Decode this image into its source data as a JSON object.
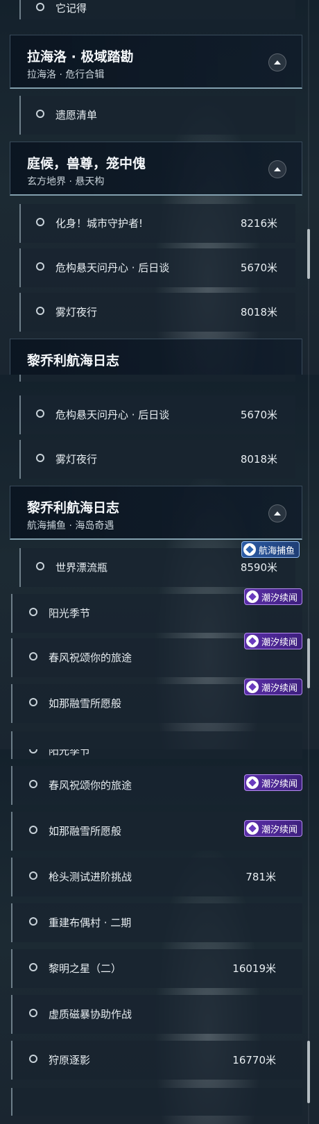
{
  "colors": {
    "tag_purple": "#5a2ea8",
    "tag_blue": "#2b5aa3",
    "panel": "#0b1620"
  },
  "section1": {
    "top_item": "它记得",
    "group_a": {
      "title": "拉海洛 · 极域踏勘",
      "subtitle": "拉海洛 · 危行合辑"
    },
    "group_a_items": [
      {
        "label": "遗愿清单"
      }
    ],
    "group_b": {
      "title": "庭候，兽尊，笼中傀",
      "subtitle": "玄方地界 · 悬天构"
    },
    "group_b_items": [
      {
        "label": "化身！城市守护者!",
        "dist": "8216米"
      },
      {
        "label": "危构悬天问丹心 · 后日谈",
        "dist": "5670米"
      },
      {
        "label": "雾灯夜行",
        "dist": "8018米"
      }
    ],
    "group_c_title": "黎乔利航海日志"
  },
  "section2": {
    "items": [
      {
        "label": "危构悬天问丹心 · 后日谈",
        "dist": "5670米"
      },
      {
        "label": "雾灯夜行",
        "dist": "8018米"
      }
    ],
    "group": {
      "title": "黎乔利航海日志",
      "subtitle": "航海捕鱼 · 海岛奇遇"
    },
    "group_items": [
      {
        "label": "世界漂流瓶",
        "dist": "8590米",
        "tag": "航海捕鱼"
      },
      {
        "label": "阳光季节",
        "tag": "潮汐续闻"
      },
      {
        "label": "春风祝颂你的旅途",
        "tag": "潮汐续闻"
      },
      {
        "label": "如那融雪所愿般",
        "tag": "潮汐续闻"
      }
    ]
  },
  "section3": {
    "partial_top": "阳光季节",
    "items": [
      {
        "label": "春风祝颂你的旅途",
        "tag": "潮汐续闻"
      },
      {
        "label": "如那融雪所愿般",
        "tag": "潮汐续闻"
      },
      {
        "label": "枪头测试进阶挑战",
        "dist": "781米"
      },
      {
        "label": "重建布偶村 · 二期"
      },
      {
        "label": "黎明之星（二）",
        "dist": "16019米"
      },
      {
        "label": "虚质磁暴协助作战"
      },
      {
        "label": "狩原逐影",
        "dist": "16770米"
      }
    ]
  },
  "icons": {
    "radio": "radio-circle-icon",
    "collapse": "chevron-up-icon",
    "tag": "diamond-badge-icon"
  }
}
